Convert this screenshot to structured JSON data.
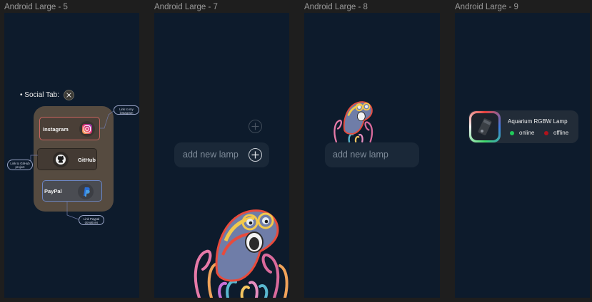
{
  "frames": [
    {
      "title": "Android Large - 5"
    },
    {
      "title": "Android Large - 7"
    },
    {
      "title": "Android Large - 8"
    },
    {
      "title": "Android Large - 9"
    }
  ],
  "frame5": {
    "social_tab_label": "• Social Tab:",
    "cards": {
      "instagram": "Instagram",
      "github": "GitHub",
      "paypal": "PayPal"
    },
    "bubbles": {
      "instagram": "Link to my instagram",
      "github": "Link to GitHub project",
      "paypal": "Link Paypal donations"
    }
  },
  "frame7": {
    "add_lamp_text": "add new lamp"
  },
  "frame8": {
    "add_lamp_text": "add new lamp"
  },
  "frame9": {
    "lamp": {
      "name": "Aquarium RGBW Lamp",
      "online_label": "online",
      "offline_label": "offline"
    }
  },
  "colors": {
    "canvas": "#1e1e1e",
    "frame_bg": "#0d1b2c",
    "online": "#1fc95a",
    "offline": "#b0121b",
    "instagram_border": "#c9645f",
    "paypal_border": "#6c86c4"
  }
}
